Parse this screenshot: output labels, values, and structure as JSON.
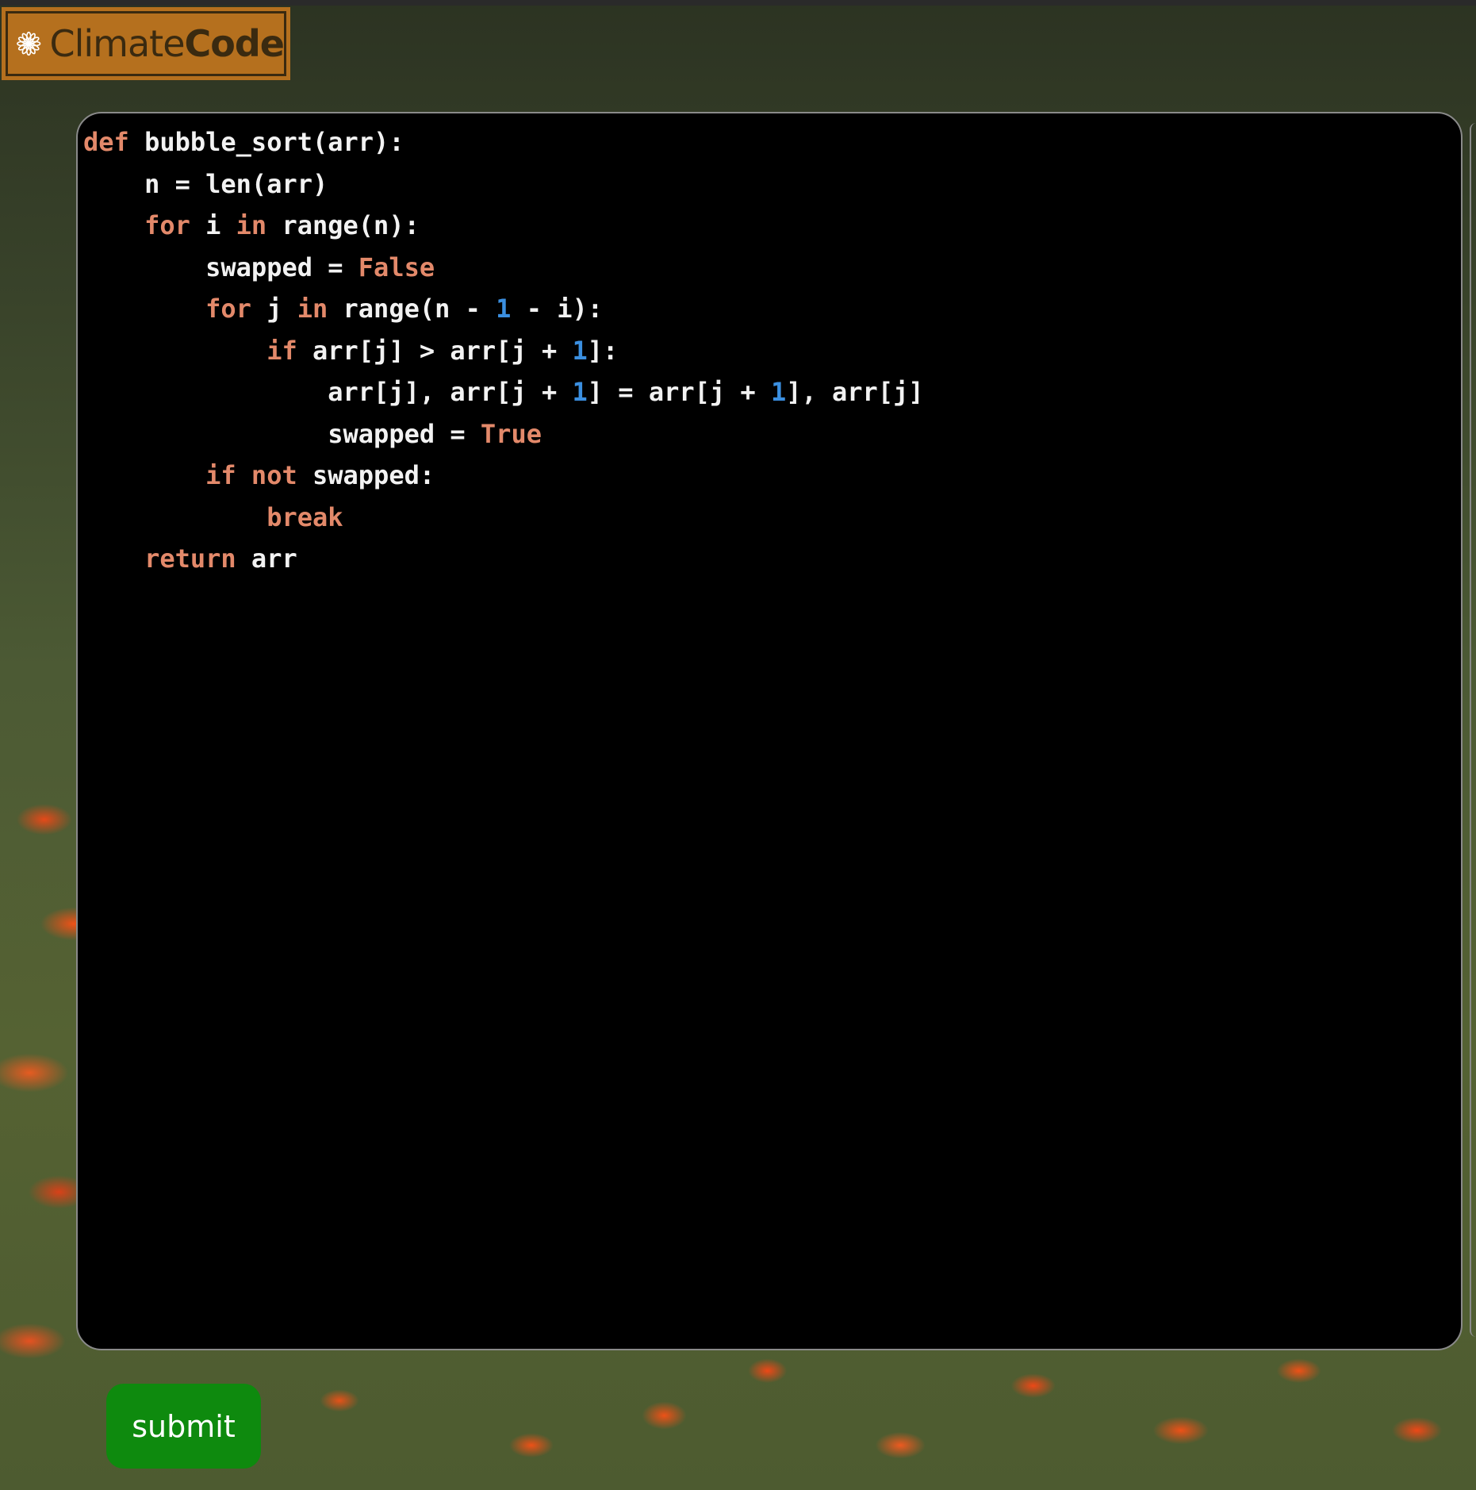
{
  "logo": {
    "text_thin": "Climate",
    "text_bold": "Code",
    "icon": "flower-icon",
    "colors": {
      "background": "#b5701e",
      "text": "#3a2a10"
    }
  },
  "editor": {
    "language": "python",
    "colors": {
      "background": "#000000",
      "keyword": "#e3896a",
      "number": "#3b8fe0",
      "text": "#f2f2f2"
    },
    "lines": [
      [
        {
          "t": "kw",
          "v": "def"
        },
        {
          "t": "tx",
          "v": " bubble_sort(arr):"
        }
      ],
      [
        {
          "t": "tx",
          "v": "    n = len(arr)"
        }
      ],
      [
        {
          "t": "tx",
          "v": "    "
        },
        {
          "t": "kw",
          "v": "for"
        },
        {
          "t": "tx",
          "v": " i "
        },
        {
          "t": "kw",
          "v": "in"
        },
        {
          "t": "tx",
          "v": " range(n):"
        }
      ],
      [
        {
          "t": "tx",
          "v": "        swapped = "
        },
        {
          "t": "kw",
          "v": "False"
        }
      ],
      [
        {
          "t": "tx",
          "v": "        "
        },
        {
          "t": "kw",
          "v": "for"
        },
        {
          "t": "tx",
          "v": " j "
        },
        {
          "t": "kw",
          "v": "in"
        },
        {
          "t": "tx",
          "v": " range(n - "
        },
        {
          "t": "num",
          "v": "1"
        },
        {
          "t": "tx",
          "v": " - i):"
        }
      ],
      [
        {
          "t": "tx",
          "v": "            "
        },
        {
          "t": "kw",
          "v": "if"
        },
        {
          "t": "tx",
          "v": " arr[j] > arr[j + "
        },
        {
          "t": "num",
          "v": "1"
        },
        {
          "t": "tx",
          "v": "]:"
        }
      ],
      [
        {
          "t": "tx",
          "v": "                arr[j], arr[j + "
        },
        {
          "t": "num",
          "v": "1"
        },
        {
          "t": "tx",
          "v": "] = arr[j + "
        },
        {
          "t": "num",
          "v": "1"
        },
        {
          "t": "tx",
          "v": "], arr[j]"
        }
      ],
      [
        {
          "t": "tx",
          "v": "                swapped = "
        },
        {
          "t": "kw",
          "v": "True"
        }
      ],
      [
        {
          "t": "tx",
          "v": "        "
        },
        {
          "t": "kw",
          "v": "if"
        },
        {
          "t": "tx",
          "v": " "
        },
        {
          "t": "kw",
          "v": "not"
        },
        {
          "t": "tx",
          "v": " swapped:"
        }
      ],
      [
        {
          "t": "tx",
          "v": "            "
        },
        {
          "t": "kw",
          "v": "break"
        }
      ],
      [
        {
          "t": "tx",
          "v": "    "
        },
        {
          "t": "kw",
          "v": "return"
        },
        {
          "t": "tx",
          "v": " arr"
        }
      ]
    ]
  },
  "submit": {
    "label": "submit",
    "color": "#0e8a0e"
  }
}
